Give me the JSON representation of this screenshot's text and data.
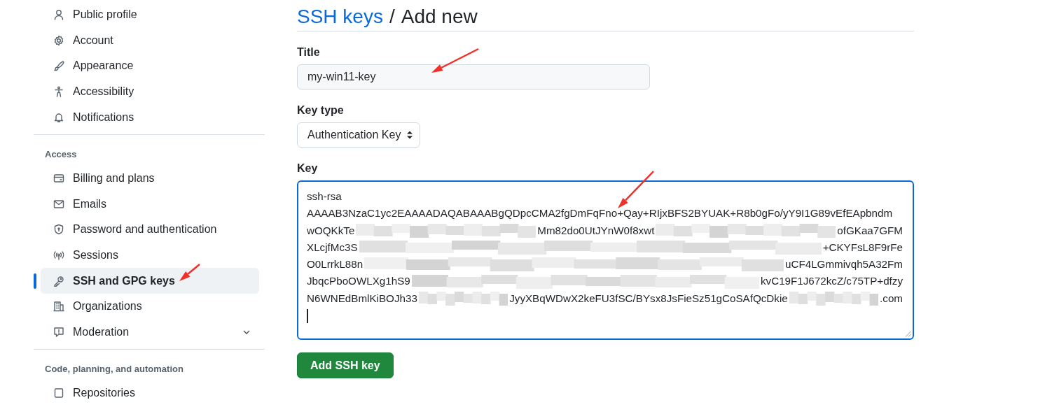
{
  "sidebar": {
    "sections": [
      {
        "items": [
          {
            "label": "Public profile",
            "selected": false,
            "kind": "link"
          },
          {
            "label": "Account",
            "selected": false,
            "kind": "link"
          },
          {
            "label": "Appearance",
            "selected": false,
            "kind": "link"
          },
          {
            "label": "Accessibility",
            "selected": false,
            "kind": "link"
          },
          {
            "label": "Notifications",
            "selected": false,
            "kind": "link"
          }
        ]
      },
      {
        "heading": "Access",
        "items": [
          {
            "label": "Billing and plans",
            "selected": false,
            "kind": "link"
          },
          {
            "label": "Emails",
            "selected": false,
            "kind": "link"
          },
          {
            "label": "Password and authentication",
            "selected": false,
            "kind": "link"
          },
          {
            "label": "Sessions",
            "selected": false,
            "kind": "link"
          },
          {
            "label": "SSH and GPG keys",
            "selected": true,
            "kind": "link"
          },
          {
            "label": "Organizations",
            "selected": false,
            "kind": "link"
          },
          {
            "label": "Moderation",
            "selected": false,
            "kind": "group"
          }
        ]
      },
      {
        "heading": "Code, planning, and automation",
        "items": [
          {
            "label": "Repositories",
            "selected": false,
            "kind": "link"
          }
        ]
      }
    ]
  },
  "page": {
    "breadcrumb_link": "SSH keys",
    "separator": "/",
    "title": "Add new"
  },
  "form": {
    "title_label": "Title",
    "title_value": "my-win11-key",
    "key_type_label": "Key type",
    "key_type_value": "Authentication Key",
    "key_label": "Key",
    "key_lines": [
      [
        "ssh-rsa"
      ],
      [
        "AAAAB3NzaC1yc2EAAAADAQABAAABgQDpcCMA2fgDmFqFno+Qay+RIjxBFS2BYUAK+R8b0gFo/yY9I1G89vEfEApbndm"
      ],
      [
        "wOQKkTe",
        "Mm82do0UtJYnW0f8xwt",
        "ofGKaa7GFM"
      ],
      [
        "XLcjfMc3S",
        "+CKYFsL8F9rFe"
      ],
      [
        "O0LrrkL88n",
        "uCF4LGmmivqh5A32Fm"
      ],
      [
        "JbqcPboOWLXg1hS9",
        "kvC19F1J672kcZ/c75TP+dfzy"
      ],
      [
        "N6WNEdBmlKiBOJh33",
        "JyyXBqWDwX2keFU3fSC/BYsx8JsFieSz51gCoSAfQcDkie",
        ".com"
      ]
    ],
    "submit": "Add SSH key"
  }
}
